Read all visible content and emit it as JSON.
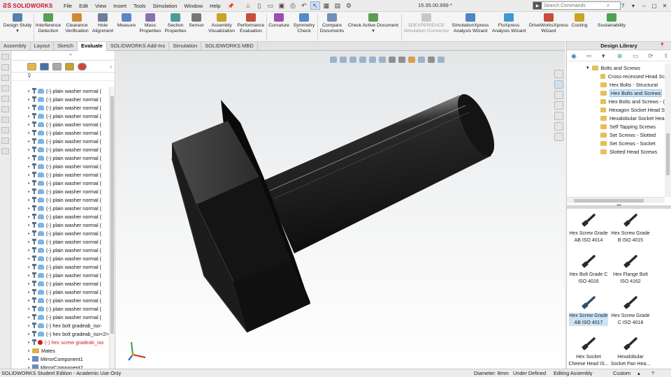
{
  "app": {
    "logo_text": "SOLIDWORKS",
    "version": "15.35.00.999 *",
    "search_placeholder": "Search Commands"
  },
  "menu": [
    "File",
    "Edit",
    "View",
    "Insert",
    "Tools",
    "Simulation",
    "Window",
    "Help"
  ],
  "commands": [
    {
      "label": "Design Study",
      "color": "#5a7fae"
    },
    {
      "label": "Interference Detection",
      "color": "#5f9c5a"
    },
    {
      "label": "Clearance Verification",
      "color": "#d08a35"
    },
    {
      "label": "Hole Alignment",
      "color": "#6d7f9b"
    },
    {
      "label": "Measure",
      "color": "#5a88c6"
    },
    {
      "label": "Mass Properties",
      "color": "#8c6fb1"
    },
    {
      "label": "Section Properties",
      "color": "#4e9a9a"
    },
    {
      "label": "Sensor",
      "color": "#777777"
    },
    {
      "label": "Assembly Visualization",
      "color": "#c9a227"
    },
    {
      "label": "Performance Evaluation",
      "color": "#c44f3c"
    },
    {
      "label": "Curvature",
      "color": "#9c4fb0"
    },
    {
      "label": "Symmetry Check",
      "color": "#5a88c6"
    },
    {
      "label": "Compare Documents",
      "color": "#7390b5"
    },
    {
      "label": "Check Active Document",
      "color": "#5f9c5a"
    },
    {
      "label": "3DEXPERIENCE Simulation Connector",
      "color": "#b8b8b8"
    },
    {
      "label": "SimulationXpress Analysis Wizard",
      "color": "#4f86c6"
    },
    {
      "label": "FloXpress Analysis Wizard",
      "color": "#3e9ad0"
    },
    {
      "label": "DriveWorksXpress Wizard",
      "color": "#c44f3c"
    },
    {
      "label": "Costing",
      "color": "#c9a227"
    },
    {
      "label": "Sustainability",
      "color": "#4fa34f"
    }
  ],
  "tabs": [
    "Assembly",
    "Layout",
    "Sketch",
    "Evaluate",
    "SOLIDWORKS Add-Ins",
    "Simulation",
    "SOLIDWORKS MBD"
  ],
  "active_tab": "Evaluate",
  "tree": {
    "washer_label": "(-) plain washer normal (",
    "washer_count": 28,
    "items": [
      {
        "label": "(-) hex bolt gradeab_iso-",
        "type": "bolt",
        "state": "normal"
      },
      {
        "label": "(-) hex bolt gradeab_iso<2>",
        "type": "bolt",
        "state": "normal"
      },
      {
        "label": "(-) hex screw gradeab_iso",
        "type": "bolt",
        "state": "error"
      },
      {
        "label": "Mates",
        "type": "folder",
        "state": "normal"
      },
      {
        "label": "MirrorComponent1",
        "type": "component",
        "state": "normal"
      },
      {
        "label": "MirrorComponent2",
        "type": "component",
        "state": "normal"
      }
    ]
  },
  "design_library": {
    "title": "Design Library",
    "tree_items": [
      {
        "label": "Bolts and Screws",
        "level": 0,
        "expanded": true
      },
      {
        "label": "Cross-recessed Head Sc",
        "level": 1
      },
      {
        "label": "Hex Bolts - Structural",
        "level": 1
      },
      {
        "label": "Hex Bolts and Screws",
        "level": 1,
        "selected": true
      },
      {
        "label": "Hex Bolts and Screws - (",
        "level": 1
      },
      {
        "label": "Hexagon Socket Head S",
        "level": 1
      },
      {
        "label": "Hexalobular Socket Hea",
        "level": 1
      },
      {
        "label": "Self Tapping Screws",
        "level": 1
      },
      {
        "label": "Set Screws - Slotted",
        "level": 1
      },
      {
        "label": "Set Screws - Socket",
        "level": 1
      },
      {
        "label": "Slotted Head Screws",
        "level": 1
      }
    ],
    "parts": [
      {
        "line1": "Hex Screw Grade",
        "line2": "AB ISO 4014",
        "color": "#2a2a2a"
      },
      {
        "line1": "Hex Screw Grade",
        "line2": "B ISO 4015",
        "color": "#2a2a2a"
      },
      {
        "line1": "Hex Bolt Grade C",
        "line2": "ISO 4016",
        "color": "#2a2a2a"
      },
      {
        "line1": "Hex Flange Bolt",
        "line2": "ISO 4162",
        "color": "#2a2a2a"
      },
      {
        "line1": "Hex Screw Grade",
        "line2": "AB ISO 4017",
        "color": "#2f4f6e",
        "selected": true
      },
      {
        "line1": "Hex Screw Grade",
        "line2": "C ISO 4018",
        "color": "#2a2a2a"
      },
      {
        "line1": "Hex Socket",
        "line2": "Cheese Head IS...",
        "color": "#2a2a2a"
      },
      {
        "line1": "Hexalobular",
        "line2": "Socket Pan Hea...",
        "color": "#2a2a2a"
      }
    ]
  },
  "status": {
    "edition": "SOLIDWORKS Student Edition - Academic Use Only",
    "measure": "Diameter: 8mm",
    "definition": "Under Defined",
    "mode": "Editing Assembly",
    "units": "Custom"
  },
  "colors": {
    "brand": "#c8102e",
    "error": "#d01a1a",
    "selection": "#cce4f7",
    "model_dark": "#1a1a1a"
  }
}
